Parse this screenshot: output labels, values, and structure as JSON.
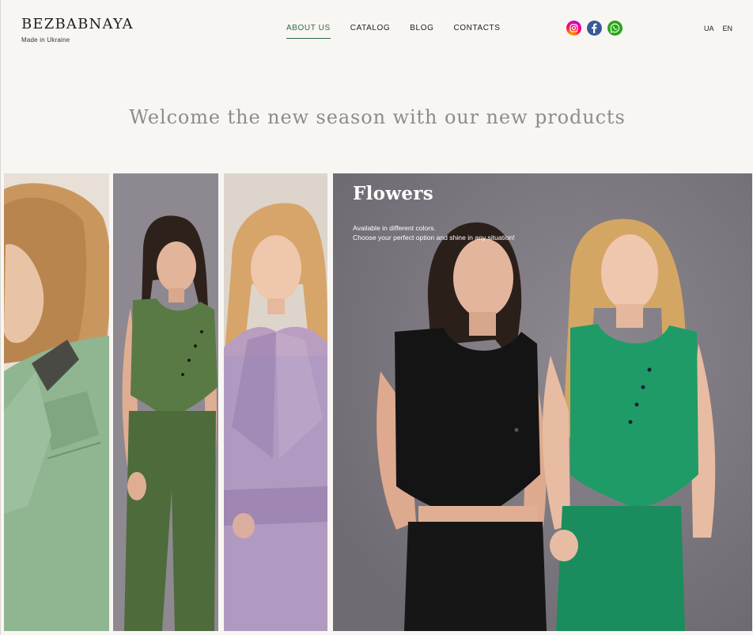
{
  "brand": {
    "name": "BEZBABNAYA",
    "tagline": "Made in Ukraine"
  },
  "nav": {
    "items": [
      {
        "label": "ABOUT US",
        "active": true
      },
      {
        "label": "CATALOG",
        "active": false
      },
      {
        "label": "BLOG",
        "active": false
      },
      {
        "label": "CONTACTS",
        "active": false
      }
    ],
    "active_color": "#2c6a4c"
  },
  "socials": [
    {
      "icon": "instagram-icon"
    },
    {
      "icon": "facebook-icon"
    },
    {
      "icon": "whatsapp-icon"
    }
  ],
  "languages": [
    "UA",
    "EN"
  ],
  "hero": {
    "headline": "Welcome the new season with our new products"
  },
  "gallery": {
    "panels": [
      {
        "name": "model-mint-jacket-photo"
      },
      {
        "name": "model-olive-vest-photo"
      },
      {
        "name": "model-lilac-coat-photo"
      },
      {
        "name": "two-models-vests-photo"
      }
    ],
    "feature": {
      "title": "Flowers",
      "desc_line1": "Available in different colors.",
      "desc_line2": "Choose your perfect option and shine in any situation!"
    }
  },
  "colors": {
    "background": "#f8f6f3",
    "headline": "#8c8c8c",
    "brand": "#1f1f1f"
  }
}
